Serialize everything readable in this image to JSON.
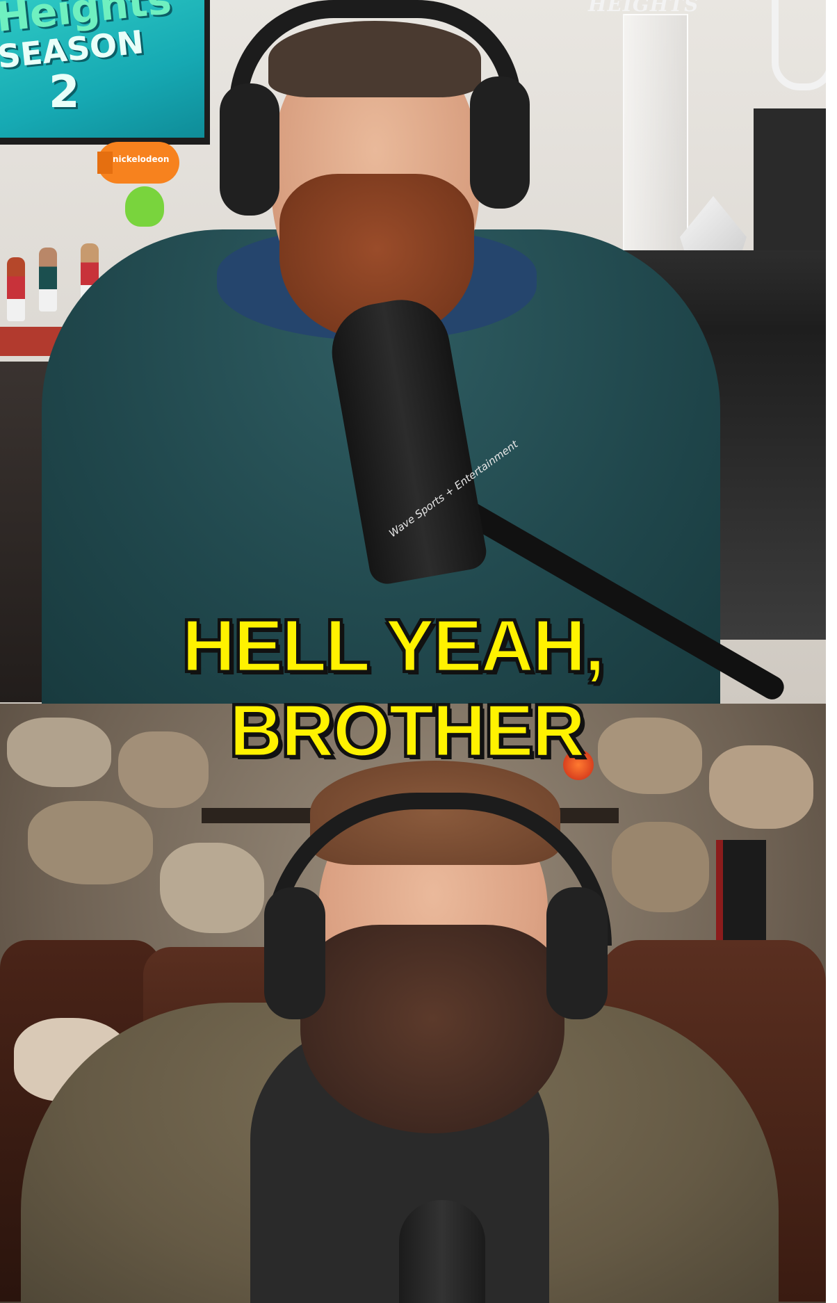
{
  "top_video": {
    "tv_text": {
      "title": "Heights",
      "season": "SEASON",
      "number": "2"
    },
    "watermark": "HEIGHTS",
    "blimp_label": "nickelodeon",
    "mic_label": "Wave Sports + Entertainment"
  },
  "caption": {
    "line1": "HELL YEAH,",
    "line2": "BROTHER",
    "color": "#fff200",
    "outline_color": "#111111"
  },
  "icons": [
    "headphones-icon",
    "microphone-icon"
  ]
}
